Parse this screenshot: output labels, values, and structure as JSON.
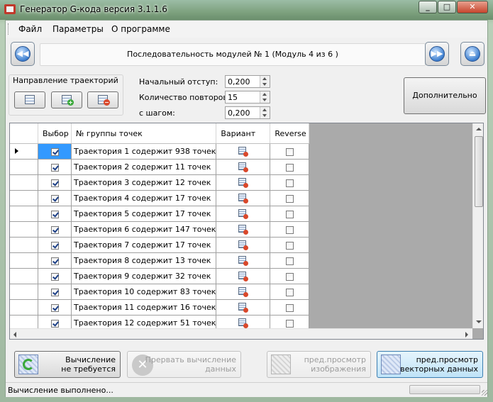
{
  "window": {
    "title": "Генератор G-кода версия 3.1.1.6"
  },
  "menu": {
    "items": [
      "Файл",
      "Параметры",
      "О программе"
    ]
  },
  "nav": {
    "sequence_label": "Последовательность модулей № 1 (Модуль 4 из 6 )"
  },
  "direction": {
    "label": "Направление траекторий"
  },
  "params": {
    "start_offset_label": "Начальный отступ:",
    "start_offset_value": "0,200",
    "repeat_label": "Количество повторов:",
    "repeat_value": "15",
    "step_label": "с шагом:",
    "step_value": "0,200"
  },
  "advanced_label": "Дополнительно",
  "grid": {
    "columns": [
      "Выбор",
      "№ группы точек",
      "Вариант",
      "Reverse"
    ],
    "rows": [
      {
        "name": "Траектория 1 содержит 938 точек",
        "selected": true,
        "reverse": false,
        "current": true
      },
      {
        "name": "Траектория 2 содержит 11 точек",
        "selected": true,
        "reverse": false
      },
      {
        "name": "Траектория 3 содержит 12 точек",
        "selected": true,
        "reverse": false
      },
      {
        "name": "Траектория 4 содержит 17 точек",
        "selected": true,
        "reverse": false
      },
      {
        "name": "Траектория 5 содержит 17 точек",
        "selected": true,
        "reverse": false
      },
      {
        "name": "Траектория 6 содержит 147 точек",
        "selected": true,
        "reverse": false
      },
      {
        "name": "Траектория 7 содержит 17 точек",
        "selected": true,
        "reverse": false
      },
      {
        "name": "Траектория 8 содержит 13 точек",
        "selected": true,
        "reverse": false
      },
      {
        "name": "Траектория 9 содержит 32 точек",
        "selected": true,
        "reverse": false
      },
      {
        "name": "Траектория 10 содержит 83 точек",
        "selected": true,
        "reverse": false
      },
      {
        "name": "Траектория 11 содержит 16 точек",
        "selected": true,
        "reverse": false
      },
      {
        "name": "Траектория 12 содержит 51 точек",
        "selected": true,
        "reverse": false
      }
    ]
  },
  "actions": {
    "calc_line1": "Вычисление",
    "calc_line2": "не требуется",
    "abort_line1": "Прервать вычисление",
    "abort_line2": "данных",
    "preview_img_line1": "пред.просмотр",
    "preview_img_line2": "изображения",
    "preview_vec_line1": "пред.просмотр",
    "preview_vec_line2": "векторных данных"
  },
  "status": {
    "text": "Вычисление выполнено..."
  },
  "icons": {
    "nav_back": "double-left-arrow-icon",
    "nav_forward": "double-right-arrow-icon",
    "eject": "eject-icon"
  }
}
